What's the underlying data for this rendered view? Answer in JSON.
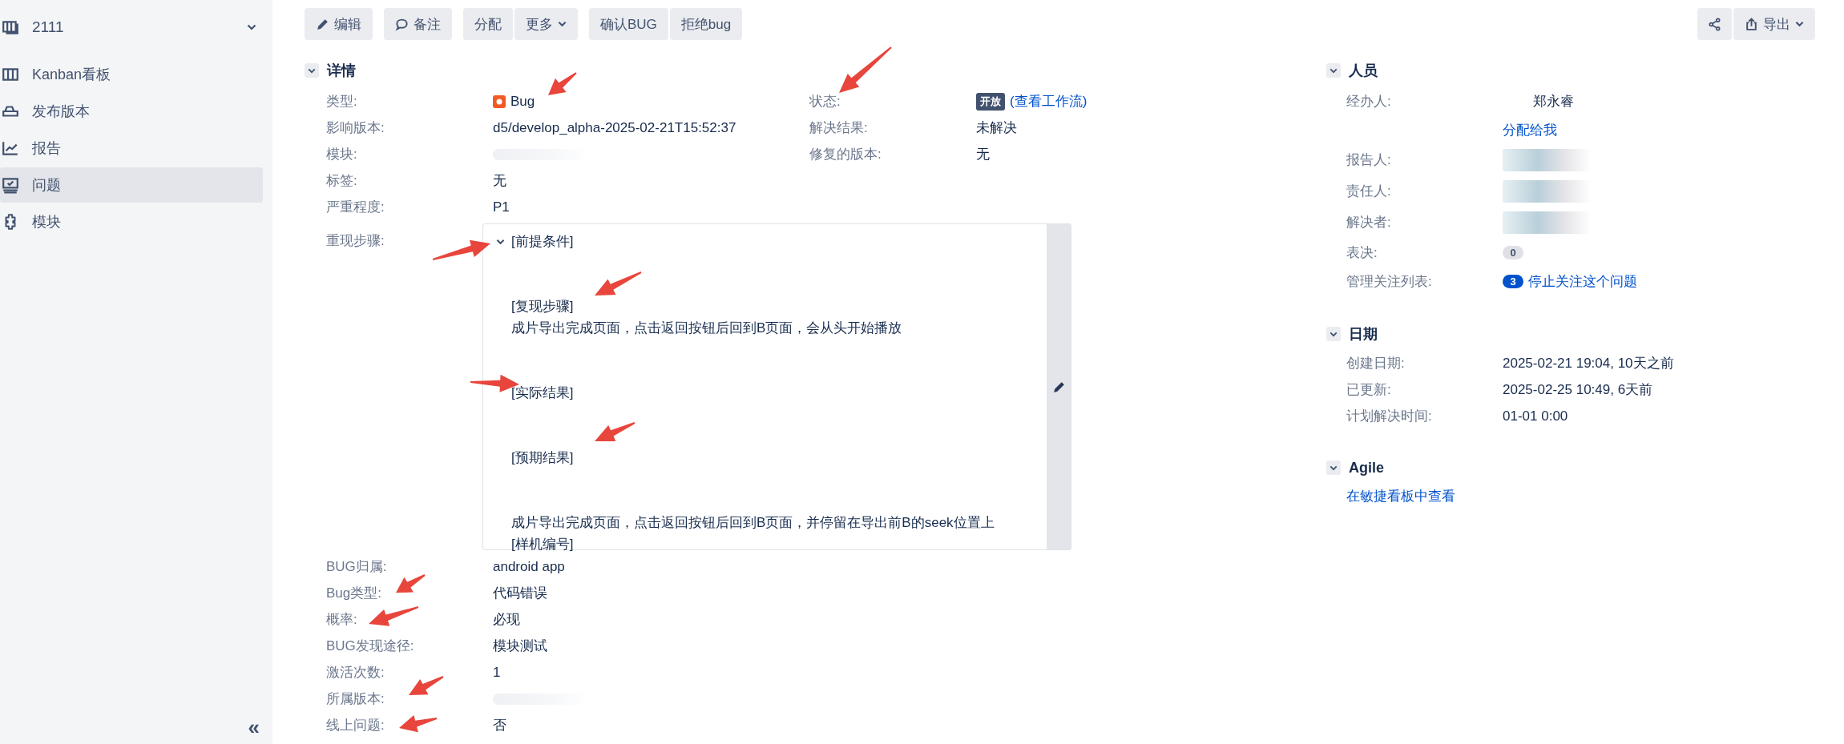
{
  "sidebar": {
    "project": {
      "name": "2111"
    },
    "items": [
      {
        "label": "Kanban看板",
        "selected": false
      },
      {
        "label": "发布版本",
        "selected": false
      },
      {
        "label": "报告",
        "selected": false
      },
      {
        "label": "问题",
        "selected": true
      },
      {
        "label": "模块",
        "selected": false
      }
    ],
    "collapse": "«"
  },
  "toolbar": {
    "groups": [
      [
        {
          "label": "编辑",
          "kind": "pencil"
        }
      ],
      [
        {
          "label": "备注",
          "kind": "comment"
        }
      ],
      [
        {
          "label": "分配",
          "kind": "plain"
        },
        {
          "label": "更多",
          "kind": "dropdown"
        }
      ],
      [
        {
          "label": "确认BUG",
          "kind": "plain"
        },
        {
          "label": "拒绝bug",
          "kind": "plain"
        }
      ]
    ],
    "export": {
      "label": "导出"
    }
  },
  "details": {
    "title": "详情",
    "expanded": true,
    "left_fields": [
      {
        "label": "类型:",
        "kind": "issue-type",
        "value": "Bug"
      },
      {
        "label": "影响版本:",
        "kind": "text",
        "value": "d5/develop_alpha-2025-02-21T15:52:37"
      },
      {
        "label": "模块:",
        "kind": "blurred"
      },
      {
        "label": "标签:",
        "kind": "text",
        "value": "无"
      },
      {
        "label": "严重程度:",
        "kind": "text",
        "value": "P1"
      }
    ],
    "right_fields": [
      {
        "label": "状态:",
        "kind": "status",
        "value": "开放",
        "link": "(查看工作流)"
      },
      {
        "label": "解决结果:",
        "kind": "text",
        "value": "未解决"
      },
      {
        "label": "修复的版本:",
        "kind": "text",
        "value": "无"
      }
    ],
    "steps": {
      "label": "重现步骤:",
      "expanded": true,
      "paragraphs": [
        [
          "[前提条件]"
        ],
        [
          "[复现步骤]",
          "成片导出完成页面，点击返回按钮后回到B页面，会从头开始播放"
        ],
        [
          "[实际结果]"
        ],
        [
          "[预期结果]"
        ],
        [
          "成片导出完成页面，点击返回按钮后回到B页面，并停留在导出前B的seek位置上",
          "[样机编号]"
        ]
      ]
    },
    "more_fields": [
      {
        "label": "BUG归属:",
        "kind": "text",
        "value": "android app"
      },
      {
        "label": "Bug类型:",
        "kind": "text",
        "value": "代码错误"
      },
      {
        "label": "概率:",
        "kind": "text",
        "value": "必现"
      },
      {
        "label": "BUG发现途径:",
        "kind": "text",
        "value": "模块测试"
      },
      {
        "label": "激活次数:",
        "kind": "text",
        "value": "1"
      },
      {
        "label": "所属版本:",
        "kind": "blurred"
      },
      {
        "label": "线上问题:",
        "kind": "text",
        "value": "否"
      }
    ]
  },
  "people": {
    "title": "人员",
    "expanded": true,
    "rows": [
      {
        "label": "经办人:",
        "kind": "person",
        "value": "郑永睿"
      },
      {
        "kind": "link",
        "value": "分配给我"
      },
      {
        "label": "报告人:",
        "kind": "blurred"
      },
      {
        "label": "责任人:",
        "kind": "blurred"
      },
      {
        "label": "解决者:",
        "kind": "blurred"
      },
      {
        "label": "表决:",
        "kind": "count",
        "count": "0"
      },
      {
        "label": "管理关注列表:",
        "kind": "watch",
        "count": "3",
        "link": "停止关注这个问题"
      }
    ]
  },
  "dates": {
    "title": "日期",
    "expanded": true,
    "rows": [
      {
        "label": "创建日期:",
        "value": "2025-02-21 19:04, 10天之前"
      },
      {
        "label": "已更新:",
        "value": "2025-02-25 10:49, 6天前"
      },
      {
        "label": "计划解决时间:",
        "value": "01-01 0:00"
      }
    ]
  },
  "agile": {
    "title": "Agile",
    "expanded": true,
    "link": "在敏捷看板中查看"
  }
}
